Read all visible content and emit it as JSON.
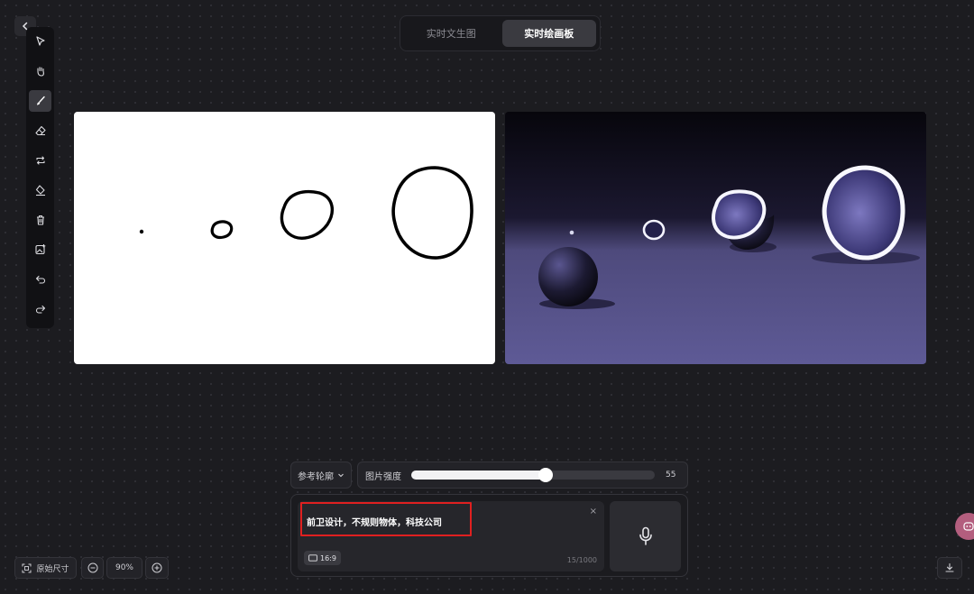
{
  "nav": {
    "back_icon": "chevron-left-icon"
  },
  "toolbar": {
    "tools": [
      {
        "name": "select",
        "icon": "cursor-arrow-icon",
        "active": false
      },
      {
        "name": "pan",
        "icon": "hand-icon",
        "active": false
      },
      {
        "name": "brush",
        "icon": "brush-icon",
        "active": true
      },
      {
        "name": "eraser",
        "icon": "eraser-icon",
        "active": false
      },
      {
        "name": "swap",
        "icon": "swap-icon",
        "active": false
      },
      {
        "name": "fill",
        "icon": "paint-bucket-icon",
        "active": false
      },
      {
        "name": "delete",
        "icon": "trash-icon",
        "active": false
      },
      {
        "name": "add-image",
        "icon": "image-add-icon",
        "active": false
      },
      {
        "name": "undo",
        "icon": "undo-icon",
        "active": false
      },
      {
        "name": "redo",
        "icon": "redo-icon",
        "active": false
      }
    ]
  },
  "mode_tabs": [
    {
      "label": "实时文生图",
      "active": false
    },
    {
      "label": "实时绘画板",
      "active": true
    }
  ],
  "controls": {
    "reference_label": "参考轮廓",
    "strength_label": "图片强度",
    "strength_value": 55,
    "strength_display": "55"
  },
  "prompt": {
    "text": "前卫设计，不规则物体，科技公司",
    "clear": "×",
    "aspect_ratio": "16:9",
    "counter": "15/1000"
  },
  "footer": {
    "original_size_label": "原始尺寸",
    "zoom": "90%"
  },
  "colors": {
    "background": "#1c1c20",
    "accent_highlight": "#e02020",
    "render_purple": "#5c5794"
  }
}
